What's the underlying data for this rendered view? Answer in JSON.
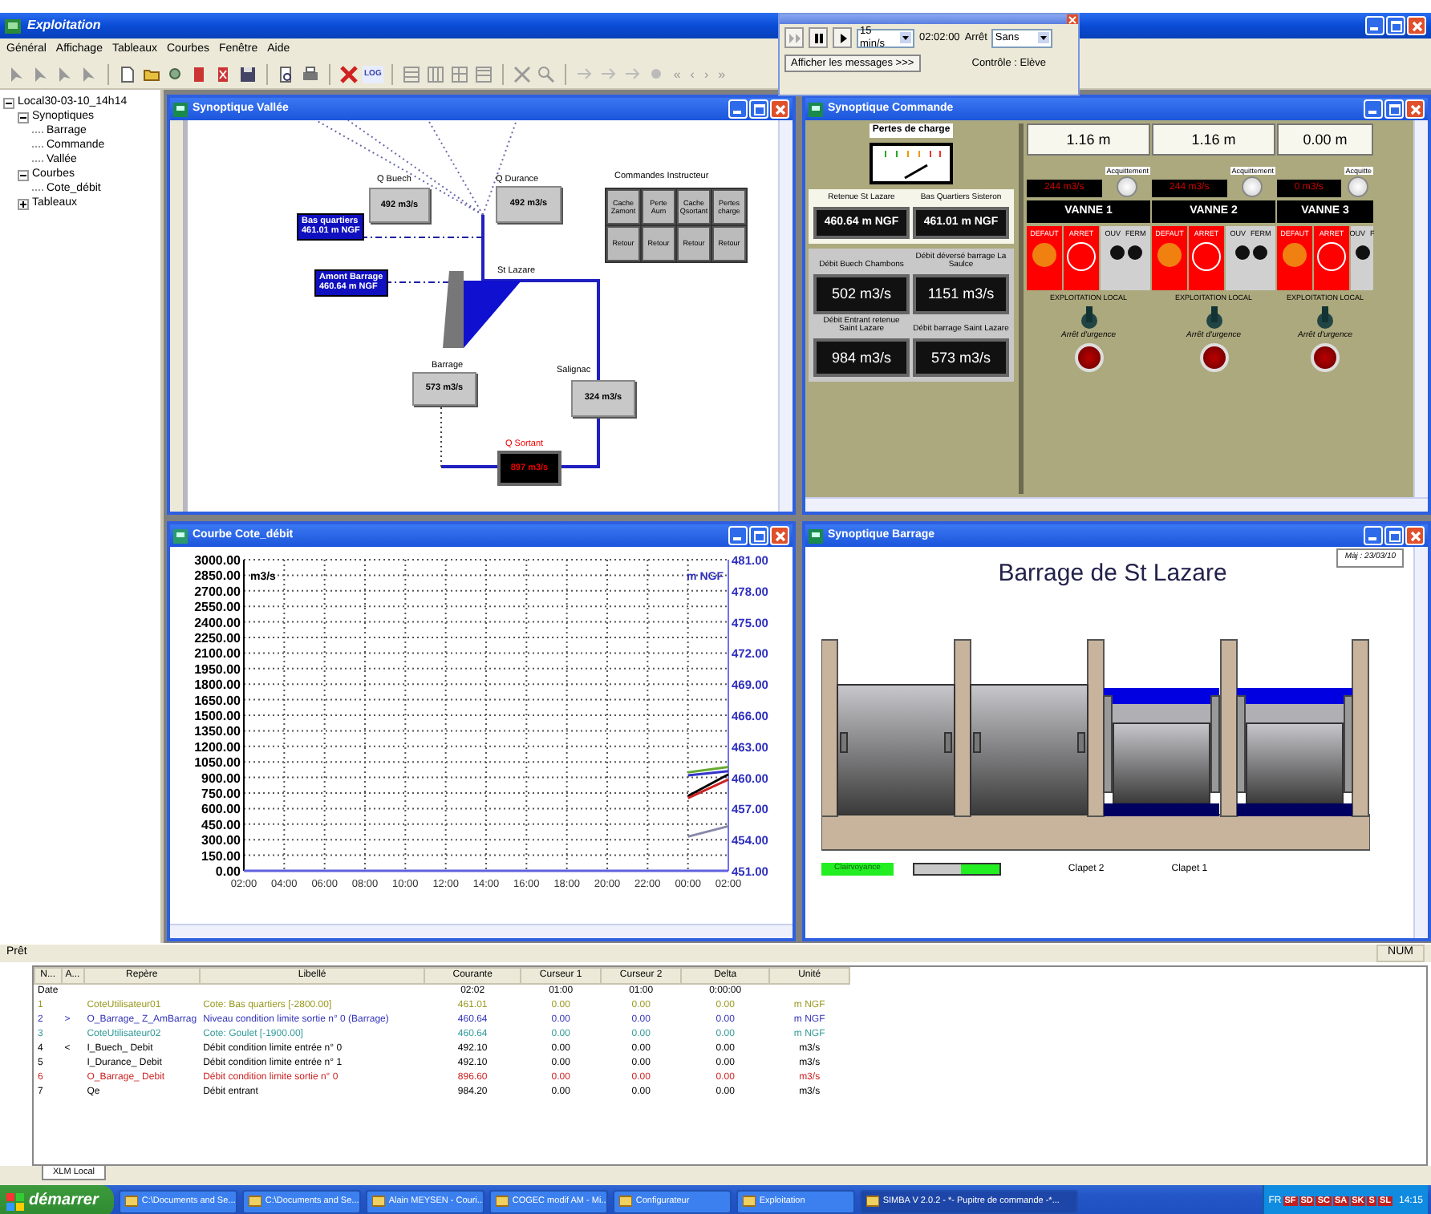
{
  "app": {
    "title": "Exploitation",
    "menu": [
      "Général",
      "Affichage",
      "Tableaux",
      "Courbes",
      "Fenêtre",
      "Aide"
    ],
    "toolbar": {
      "log_label": "LOG",
      "nav_glyphs": [
        "«",
        "‹",
        "›",
        "»"
      ]
    }
  },
  "player": {
    "speed": "15 min/s",
    "time": "02:02:00",
    "stop_label": "Arrêt",
    "mode": "Sans",
    "messages_button": "Afficher les messages >>>",
    "control_label": "Contrôle : Elève"
  },
  "tree": [
    {
      "label": "Local30-03-10_14h14",
      "expanded": true,
      "children": [
        {
          "label": "Synoptiques",
          "expanded": true,
          "children": [
            {
              "label": "Barrage"
            },
            {
              "label": "Commande"
            },
            {
              "label": "Vallée"
            }
          ]
        },
        {
          "label": "Courbes",
          "expanded": true,
          "children": [
            {
              "label": "Cote_débit"
            }
          ]
        },
        {
          "label": "Tableaux",
          "expanded": false
        }
      ]
    }
  ],
  "windows": {
    "vallee": {
      "title": "Synoptique Vallée",
      "nodes": [
        {
          "kind": "flow",
          "label": "Q Buech",
          "value": "492 m3/s"
        },
        {
          "kind": "flow",
          "label": "Q Durance",
          "value": "492 m3/s"
        },
        {
          "kind": "level",
          "label": "Bas quartiers",
          "value": "461.01 m NGF"
        },
        {
          "kind": "level",
          "label": "Amont Barrage",
          "value": "460.64 m NGF"
        },
        {
          "kind": "text",
          "label": "St Lazare"
        },
        {
          "kind": "flow",
          "label": "Barrage",
          "value": "573 m3/s"
        },
        {
          "kind": "flow",
          "label": "Salignac",
          "value": "324 m3/s"
        },
        {
          "kind": "alarm",
          "label": "Q Sortant",
          "value": "897 m3/s"
        }
      ],
      "commands": {
        "label": "Commandes Instructeur",
        "buttons": [
          "Cache Zamont",
          "Perte Aum",
          "Cache Qsortant",
          "Pertes charge",
          "Retour",
          "Retour",
          "Retour",
          "Retour"
        ]
      }
    },
    "commande": {
      "title": "Synoptique Commande",
      "losses_label": "Pertes de charge",
      "levels": [
        {
          "label": "Retenue St Lazare",
          "value": "460.64 m NGF"
        },
        {
          "label": "Bas Quartiers Sisteron",
          "value": "461.01 m NGF"
        }
      ],
      "flows": [
        {
          "label": "Débit Buech Chambons",
          "value": "502 m3/s"
        },
        {
          "label": "Débit déversé barrage La Saulce",
          "value": "1151 m3/s"
        },
        {
          "label": "Débit Entrant retenue Saint Lazare",
          "value": "984 m3/s"
        },
        {
          "label": "Débit barrage Saint Lazare",
          "value": "573 m3/s"
        }
      ],
      "gates": [
        {
          "height": "1.16 m",
          "flow": "244 m3/s",
          "ack_label": "Acquittement",
          "name": "VANNE 1",
          "fault_label": "DEFAUT",
          "stop_label": "ARRET",
          "open_label": "OUV",
          "close_label": "FERM",
          "mode_label": "EXPLOITATION LOCAL",
          "emergency_label": "Arrêt d'urgence"
        },
        {
          "height": "1.16 m",
          "flow": "244 m3/s",
          "ack_label": "Acquittement",
          "name": "VANNE 2",
          "fault_label": "DEFAUT",
          "stop_label": "ARRET",
          "open_label": "OUV",
          "close_label": "FERM",
          "mode_label": "EXPLOITATION LOCAL",
          "emergency_label": "Arrêt d'urgence"
        },
        {
          "height": "0.00 m",
          "flow": "0 m3/s",
          "ack_label": "Acquitte",
          "name": "VANNE 3",
          "fault_label": "DEFAUT",
          "stop_label": "ARRET",
          "open_label": "OUV",
          "close_label": "F",
          "mode_label": "EXPLOITATION LOCAL",
          "emergency_label": "Arrêt d'urgence"
        }
      ]
    },
    "courbe": {
      "title": "Courbe Cote_débit",
      "right_unit": "m NGF",
      "right_ticks": [
        "481.00",
        "478.00",
        "475.00",
        "472.00",
        "469.00",
        "466.00",
        "463.00",
        "460.00",
        "457.00",
        "454.00",
        "451.00"
      ],
      "chart_data": {
        "type": "line",
        "grid": true,
        "ylabel": "m3/s",
        "ylim": [
          0,
          3000
        ],
        "categories": [
          "02:00",
          "04:00",
          "06:00",
          "08:00",
          "10:00",
          "12:00",
          "14:00",
          "16:00",
          "18:00",
          "20:00",
          "22:00",
          "00:00",
          "02:00"
        ],
        "yticks": [
          {
            "value": 0,
            "label": "0.00"
          },
          {
            "value": 150,
            "label": "150.00"
          },
          {
            "value": 300,
            "label": "300.00"
          },
          {
            "value": 450,
            "label": "450.00"
          },
          {
            "value": 600,
            "label": "600.00"
          },
          {
            "value": 750,
            "label": "750.00"
          },
          {
            "value": 900,
            "label": "900.00"
          },
          {
            "value": 1050,
            "label": "1050.00"
          },
          {
            "value": 1200,
            "label": "1200.00"
          },
          {
            "value": 1350,
            "label": "1350.00"
          },
          {
            "value": 1500,
            "label": "1500.00"
          },
          {
            "value": 1650,
            "label": "1650.00"
          },
          {
            "value": 1800,
            "label": "1800.00"
          },
          {
            "value": 1950,
            "label": "1950.00"
          },
          {
            "value": 2100,
            "label": "2100.00"
          },
          {
            "value": 2250,
            "label": "2250.00"
          },
          {
            "value": 2400,
            "label": "2400.00"
          },
          {
            "value": 2550,
            "label": "2550.00"
          },
          {
            "value": 2700,
            "label": "2700.00"
          },
          {
            "value": 2850,
            "label": "2850.00"
          },
          {
            "value": 3000,
            "label": "3000.00"
          }
        ],
        "series": [
          {
            "color": "#66aa33",
            "values": [
              null,
              null,
              null,
              null,
              null,
              null,
              null,
              null,
              null,
              null,
              null,
              950,
              1000
            ]
          },
          {
            "color": "#3333cc",
            "values": [
              null,
              null,
              null,
              null,
              null,
              null,
              null,
              null,
              null,
              null,
              null,
              920,
              960
            ]
          },
          {
            "color": "#000000",
            "values": [
              null,
              null,
              null,
              null,
              null,
              null,
              null,
              null,
              null,
              null,
              null,
              720,
              930
            ]
          },
          {
            "color": "#cc2222",
            "values": [
              null,
              null,
              null,
              null,
              null,
              null,
              null,
              null,
              null,
              null,
              null,
              700,
              880
            ]
          },
          {
            "color": "#8888aa",
            "values": [
              null,
              null,
              null,
              null,
              null,
              null,
              null,
              null,
              null,
              null,
              null,
              330,
              430
            ]
          }
        ]
      }
    },
    "barrage": {
      "title": "Synoptique Barrage",
      "heading": "Barrage de St Lazare",
      "update": "Màj : 23/03/10",
      "status_label": "Clairvoyance",
      "gates": [
        {
          "label": "Clapet 2"
        },
        {
          "label": "Clapet 1"
        }
      ]
    }
  },
  "status_bar": {
    "message": "Prêt",
    "indicator": "NUM"
  },
  "table": {
    "columns": [
      "N...",
      "A...",
      "Repère",
      "Libellé",
      "Courante",
      "Curseur 1",
      "Curseur 2",
      "Delta",
      "Unité"
    ],
    "rows": [
      {
        "cells": [
          "Date",
          "",
          "",
          "",
          "02:02",
          "01:00",
          "01:00",
          "0:00:00",
          ""
        ],
        "color": "#000000"
      },
      {
        "cells": [
          "1",
          "",
          "CoteUtilisateur01",
          "Cote: Bas quartiers [-2800.00]",
          "461.01",
          "0.00",
          "0.00",
          "0.00",
          "m NGF"
        ],
        "color": "#999922"
      },
      {
        "cells": [
          "2",
          ">",
          "O_Barrage_ Z_AmBarrag",
          "Niveau condition limite sortie n° 0 (Barrage)",
          "460.64",
          "0.00",
          "0.00",
          "0.00",
          "m NGF"
        ],
        "color": "#3333bb"
      },
      {
        "cells": [
          "3",
          "",
          "CoteUtilisateur02",
          "Cote: Goulet [-1900.00]",
          "460.64",
          "0.00",
          "0.00",
          "0.00",
          "m NGF"
        ],
        "color": "#339999"
      },
      {
        "cells": [
          "4",
          "<",
          "I_Buech_ Debit",
          "Débit condition limite entrée n° 0",
          "492.10",
          "0.00",
          "0.00",
          "0.00",
          "m3/s"
        ],
        "color": "#000000"
      },
      {
        "cells": [
          "5",
          "",
          "I_Durance_ Debit",
          "Débit condition limite entrée n° 1",
          "492.10",
          "0.00",
          "0.00",
          "0.00",
          "m3/s"
        ],
        "color": "#000000"
      },
      {
        "cells": [
          "6",
          "",
          "O_Barrage_ Debit",
          "Débit condition limite sortie n° 0",
          "896.60",
          "0.00",
          "0.00",
          "0.00",
          "m3/s"
        ],
        "color": "#cc2222"
      },
      {
        "cells": [
          "7",
          "",
          "Qe",
          "Débit entrant",
          "984.20",
          "0.00",
          "0.00",
          "0.00",
          "m3/s"
        ],
        "color": "#000000"
      }
    ],
    "tab": "XLM Local"
  },
  "taskbar": {
    "start": "démarrer",
    "items": [
      {
        "label": "C:\\Documents and Se...",
        "selected": false
      },
      {
        "label": "C:\\Documents and Se...",
        "selected": false
      },
      {
        "label": "Alain MEYSEN - Couri...",
        "selected": false
      },
      {
        "label": "COGEC modif AM - Mi...",
        "selected": false
      },
      {
        "label": "Configurateur",
        "selected": false
      },
      {
        "label": "Exploitation",
        "selected": false
      },
      {
        "label": "SIMBA V 2.0.2 - *- Pupitre de commande -*...",
        "selected": true
      }
    ],
    "tray": {
      "lang": "FR",
      "badges": [
        "SF",
        "SD",
        "SC",
        "SA",
        "SK",
        "S",
        "SL"
      ],
      "clock": "14:15"
    }
  }
}
